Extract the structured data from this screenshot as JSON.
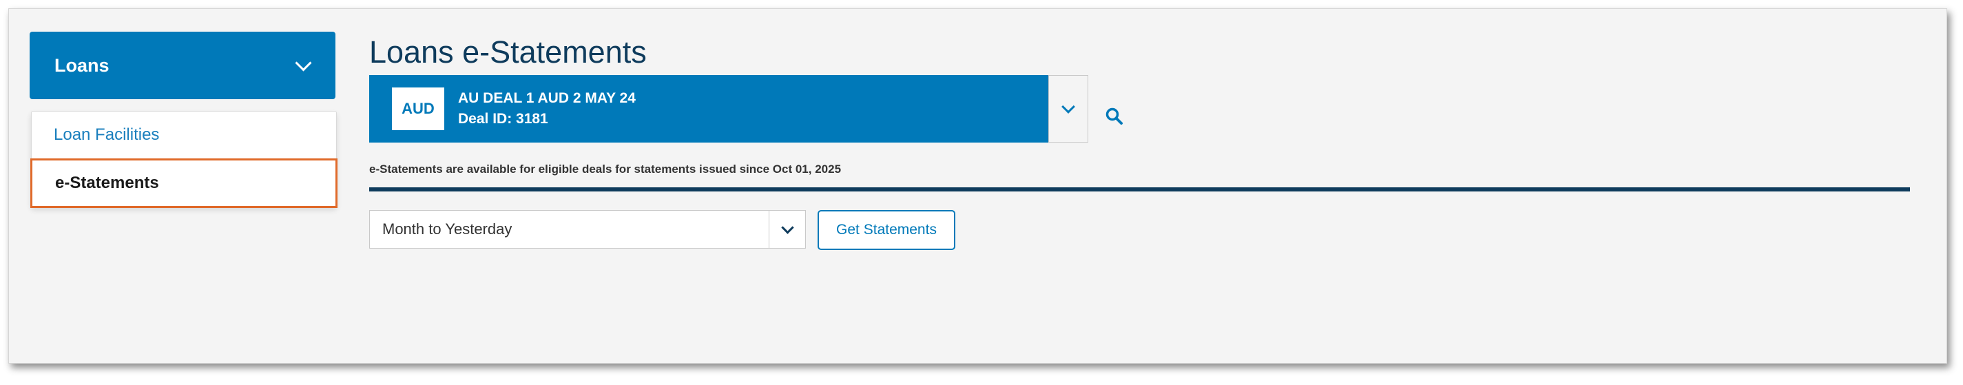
{
  "sidebar": {
    "header": {
      "label": "Loans",
      "icon": "chevron-down-icon"
    },
    "items": [
      {
        "label": "Loan Facilities",
        "active": false
      },
      {
        "label": "e-Statements",
        "active": true
      }
    ]
  },
  "main": {
    "title": "Loans e-Statements",
    "deal": {
      "currency": "AUD",
      "name": "AU DEAL 1 AUD 2 MAY 24",
      "deal_id": "Deal ID: 3181"
    },
    "availability_note": "e-Statements are available for eligible deals for statements issued since Oct 01, 2025",
    "period_select": {
      "value": "Month to Yesterday"
    },
    "get_button_label": "Get Statements"
  },
  "colors": {
    "brand_blue": "#0079b9",
    "navy": "#0e3b5c",
    "active_outline": "#e06a2a",
    "background": "#f4f4f4"
  }
}
